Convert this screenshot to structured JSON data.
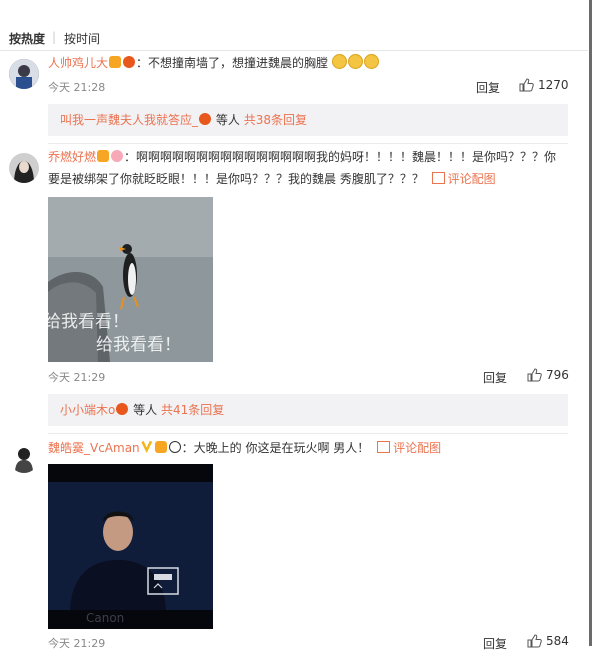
{
  "sort": {
    "hot": "按热度",
    "separator": "|",
    "time": "按时间"
  },
  "comments": [
    {
      "username": "人帅鸡儿大",
      "text": "：不想撞南墙了，想撞进魏晨的胸膛",
      "time": "今天 21:28",
      "reply": "回复",
      "likes": "1270",
      "replies_summary": {
        "name": "叫我一声魏夫人我就答应_",
        "suffix": "等人",
        "count": "共38条回复"
      }
    },
    {
      "username": "乔燃好燃",
      "text_line1": "：啊啊啊啊啊啊啊啊啊啊啊啊啊啊啊我的妈呀！！！！魏晨！！！是你吗？？？你",
      "text_line2": "要是被绑架了你就眨眨眼！！！是你吗？？？我的魏晨 秀腹肌了？？？",
      "pic_link": "评论配图",
      "image_caption": "给我看看！",
      "time": "今天 21:29",
      "reply": "回复",
      "likes": "796",
      "replies_summary": {
        "name": "小小端木o",
        "suffix": "等人",
        "count": "共41条回复"
      }
    },
    {
      "username": "魏皓霙_VcAman",
      "text": "：大晚上的 你这是在玩火啊 男人！",
      "pic_link": "评论配图",
      "image_watermark": "Canon",
      "time": "今天 21:29",
      "reply": "回复",
      "likes": "584"
    }
  ],
  "colors": {
    "accent": "#eb7350",
    "subbox_bg": "#f2f2f5",
    "text": "#333333",
    "muted": "#888888"
  },
  "icons": {
    "like": "thumbs-up-icon",
    "pic": "picture-icon"
  }
}
